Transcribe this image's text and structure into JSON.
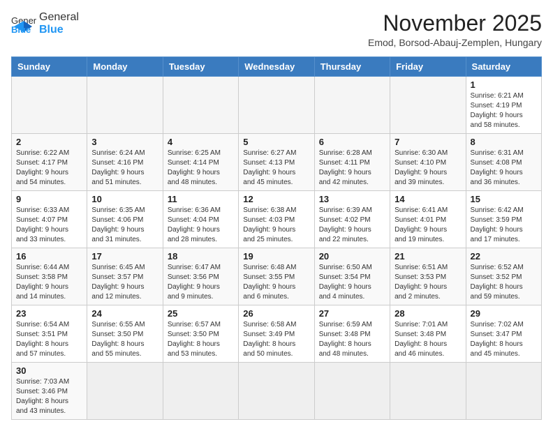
{
  "header": {
    "logo_general": "General",
    "logo_blue": "Blue",
    "title": "November 2025",
    "subtitle": "Emod, Borsod-Abauj-Zemplen, Hungary"
  },
  "weekdays": [
    "Sunday",
    "Monday",
    "Tuesday",
    "Wednesday",
    "Thursday",
    "Friday",
    "Saturday"
  ],
  "weeks": [
    [
      {
        "day": "",
        "info": ""
      },
      {
        "day": "",
        "info": ""
      },
      {
        "day": "",
        "info": ""
      },
      {
        "day": "",
        "info": ""
      },
      {
        "day": "",
        "info": ""
      },
      {
        "day": "",
        "info": ""
      },
      {
        "day": "1",
        "info": "Sunrise: 6:21 AM\nSunset: 4:19 PM\nDaylight: 9 hours\nand 58 minutes."
      }
    ],
    [
      {
        "day": "2",
        "info": "Sunrise: 6:22 AM\nSunset: 4:17 PM\nDaylight: 9 hours\nand 54 minutes."
      },
      {
        "day": "3",
        "info": "Sunrise: 6:24 AM\nSunset: 4:16 PM\nDaylight: 9 hours\nand 51 minutes."
      },
      {
        "day": "4",
        "info": "Sunrise: 6:25 AM\nSunset: 4:14 PM\nDaylight: 9 hours\nand 48 minutes."
      },
      {
        "day": "5",
        "info": "Sunrise: 6:27 AM\nSunset: 4:13 PM\nDaylight: 9 hours\nand 45 minutes."
      },
      {
        "day": "6",
        "info": "Sunrise: 6:28 AM\nSunset: 4:11 PM\nDaylight: 9 hours\nand 42 minutes."
      },
      {
        "day": "7",
        "info": "Sunrise: 6:30 AM\nSunset: 4:10 PM\nDaylight: 9 hours\nand 39 minutes."
      },
      {
        "day": "8",
        "info": "Sunrise: 6:31 AM\nSunset: 4:08 PM\nDaylight: 9 hours\nand 36 minutes."
      }
    ],
    [
      {
        "day": "9",
        "info": "Sunrise: 6:33 AM\nSunset: 4:07 PM\nDaylight: 9 hours\nand 33 minutes."
      },
      {
        "day": "10",
        "info": "Sunrise: 6:35 AM\nSunset: 4:06 PM\nDaylight: 9 hours\nand 31 minutes."
      },
      {
        "day": "11",
        "info": "Sunrise: 6:36 AM\nSunset: 4:04 PM\nDaylight: 9 hours\nand 28 minutes."
      },
      {
        "day": "12",
        "info": "Sunrise: 6:38 AM\nSunset: 4:03 PM\nDaylight: 9 hours\nand 25 minutes."
      },
      {
        "day": "13",
        "info": "Sunrise: 6:39 AM\nSunset: 4:02 PM\nDaylight: 9 hours\nand 22 minutes."
      },
      {
        "day": "14",
        "info": "Sunrise: 6:41 AM\nSunset: 4:01 PM\nDaylight: 9 hours\nand 19 minutes."
      },
      {
        "day": "15",
        "info": "Sunrise: 6:42 AM\nSunset: 3:59 PM\nDaylight: 9 hours\nand 17 minutes."
      }
    ],
    [
      {
        "day": "16",
        "info": "Sunrise: 6:44 AM\nSunset: 3:58 PM\nDaylight: 9 hours\nand 14 minutes."
      },
      {
        "day": "17",
        "info": "Sunrise: 6:45 AM\nSunset: 3:57 PM\nDaylight: 9 hours\nand 12 minutes."
      },
      {
        "day": "18",
        "info": "Sunrise: 6:47 AM\nSunset: 3:56 PM\nDaylight: 9 hours\nand 9 minutes."
      },
      {
        "day": "19",
        "info": "Sunrise: 6:48 AM\nSunset: 3:55 PM\nDaylight: 9 hours\nand 6 minutes."
      },
      {
        "day": "20",
        "info": "Sunrise: 6:50 AM\nSunset: 3:54 PM\nDaylight: 9 hours\nand 4 minutes."
      },
      {
        "day": "21",
        "info": "Sunrise: 6:51 AM\nSunset: 3:53 PM\nDaylight: 9 hours\nand 2 minutes."
      },
      {
        "day": "22",
        "info": "Sunrise: 6:52 AM\nSunset: 3:52 PM\nDaylight: 8 hours\nand 59 minutes."
      }
    ],
    [
      {
        "day": "23",
        "info": "Sunrise: 6:54 AM\nSunset: 3:51 PM\nDaylight: 8 hours\nand 57 minutes."
      },
      {
        "day": "24",
        "info": "Sunrise: 6:55 AM\nSunset: 3:50 PM\nDaylight: 8 hours\nand 55 minutes."
      },
      {
        "day": "25",
        "info": "Sunrise: 6:57 AM\nSunset: 3:50 PM\nDaylight: 8 hours\nand 53 minutes."
      },
      {
        "day": "26",
        "info": "Sunrise: 6:58 AM\nSunset: 3:49 PM\nDaylight: 8 hours\nand 50 minutes."
      },
      {
        "day": "27",
        "info": "Sunrise: 6:59 AM\nSunset: 3:48 PM\nDaylight: 8 hours\nand 48 minutes."
      },
      {
        "day": "28",
        "info": "Sunrise: 7:01 AM\nSunset: 3:48 PM\nDaylight: 8 hours\nand 46 minutes."
      },
      {
        "day": "29",
        "info": "Sunrise: 7:02 AM\nSunset: 3:47 PM\nDaylight: 8 hours\nand 45 minutes."
      }
    ],
    [
      {
        "day": "30",
        "info": "Sunrise: 7:03 AM\nSunset: 3:46 PM\nDaylight: 8 hours\nand 43 minutes."
      },
      {
        "day": "",
        "info": ""
      },
      {
        "day": "",
        "info": ""
      },
      {
        "day": "",
        "info": ""
      },
      {
        "day": "",
        "info": ""
      },
      {
        "day": "",
        "info": ""
      },
      {
        "day": "",
        "info": ""
      }
    ]
  ]
}
